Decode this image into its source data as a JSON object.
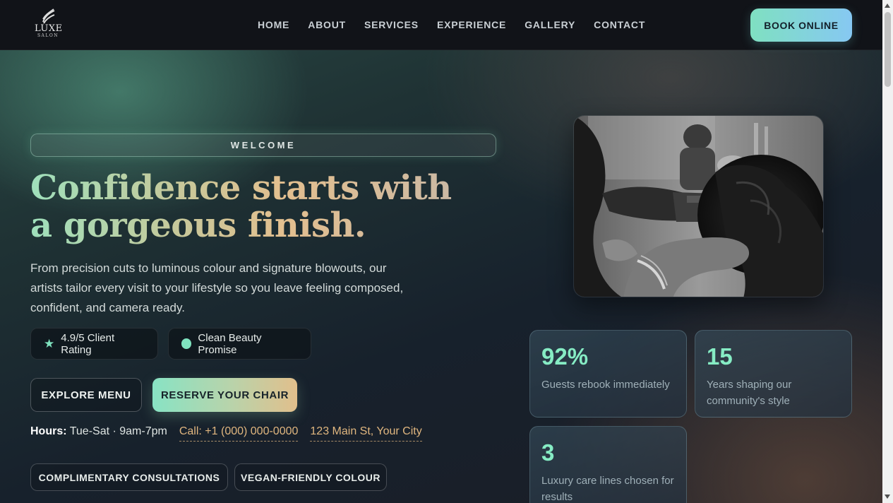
{
  "brand": {
    "name": "LUXE",
    "sub": "SALON"
  },
  "nav": {
    "links": [
      "HOME",
      "ABOUT",
      "SERVICES",
      "EXPERIENCE",
      "GALLERY",
      "CONTACT"
    ],
    "cta": "BOOK ONLINE"
  },
  "hero": {
    "eyebrow": "WELCOME",
    "headline_line1": "Confidence starts with",
    "headline_line2": "a gorgeous finish.",
    "lead": "From precision cuts to luminous colour and signature blowouts, our artists tailor every visit to your lifestyle so you leave feeling composed, confident, and camera ready.",
    "badges": {
      "rating": "4.9/5 Client Rating",
      "clean": "Clean Beauty Promise"
    },
    "buttons": {
      "explore": "EXPLORE MENU",
      "reserve": "RESERVE YOUR CHAIR"
    },
    "info": {
      "hours_label": "Hours:",
      "hours_value": "Tue-Sat · 9am-7pm",
      "phone": "Call: +1 (000) 000-0000",
      "address": "123 Main St, Your City"
    },
    "tags": [
      "COMPLIMENTARY CONSULTATIONS",
      "VEGAN-FRIENDLY COLOUR"
    ]
  },
  "stats": [
    {
      "value": "92%",
      "label": "Guests rebook immediately"
    },
    {
      "value": "15",
      "label": "Years shaping our community's style"
    },
    {
      "value": "3",
      "label": "Luxury care lines chosen for results"
    }
  ],
  "colors": {
    "accent_mint": "#86ecc4",
    "accent_gold": "#e0b67f",
    "cta_gradient_start": "#7fe0c1",
    "cta_gradient_end": "#86c8f2"
  },
  "icons": {
    "rating": "star-icon",
    "clean": "dot-icon",
    "logo": "leaf-wave-icon"
  }
}
